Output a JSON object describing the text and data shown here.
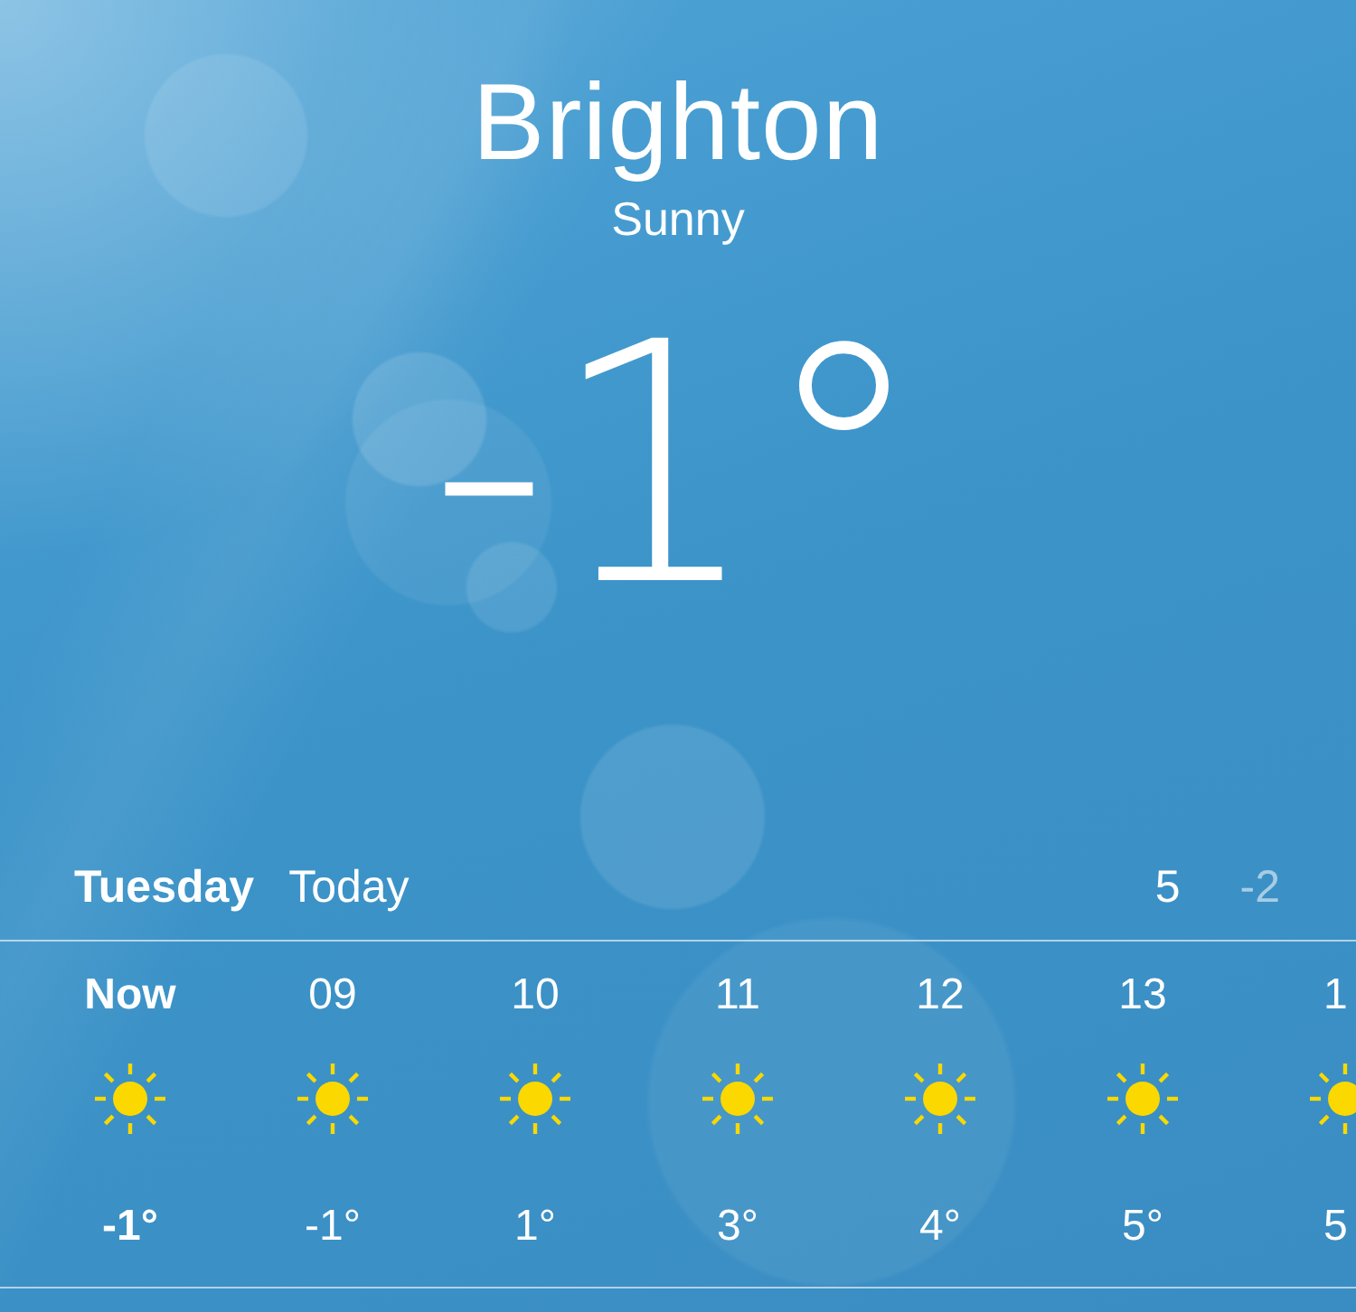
{
  "location": {
    "city": "Brighton",
    "condition": "Sunny",
    "temperature": "-1°"
  },
  "today": {
    "day": "Tuesday",
    "label": "Today",
    "high": "5",
    "low": "-2"
  },
  "hourly": [
    {
      "time": "Now",
      "temperature": "-1°",
      "current": true
    },
    {
      "time": "09",
      "temperature": "-1°",
      "current": false
    },
    {
      "time": "10",
      "temperature": "1°",
      "current": false
    },
    {
      "time": "11",
      "temperature": "3°",
      "current": false
    },
    {
      "time": "12",
      "temperature": "4°",
      "current": false
    },
    {
      "time": "13",
      "temperature": "5°",
      "current": false
    },
    {
      "time": "1",
      "temperature": "5",
      "current": false
    }
  ]
}
